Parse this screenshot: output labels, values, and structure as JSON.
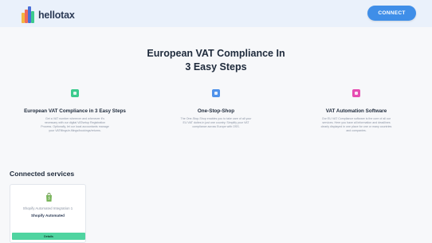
{
  "header": {
    "brand": "hellotax",
    "connect_label": "CONNECT"
  },
  "hero": {
    "title_line1": "European VAT Compliance In",
    "title_line2": "3 Easy Steps"
  },
  "features": [
    {
      "icon": "document-icon",
      "color": "#3ccb8e",
      "title": "European VAT Compliance in 3 Easy Steps",
      "text": "Get a VAT number wherever and whenever it's necessary with our digital VATsetup Registration Process. Optionally, let our local accountants manage your VATfilings/e-filings/bookings/returns."
    },
    {
      "icon": "one-stop-shop-icon",
      "color": "#4f92ea",
      "title": "One-Stop-Shop",
      "text": "The One-Stop-Shop enables you to take care of all your EU VAT duties in just one country. Simplify your VAT compliance across Europe with OSS."
    },
    {
      "icon": "automation-icon",
      "color": "#e64db2",
      "title": "VAT Automation Software",
      "text": "Our EU VAT Compliance software is the core of all our services. Here you have all information and deadlines clearly displayed in one place for one or many countries and companies."
    }
  ],
  "connected": {
    "title": "Connected services",
    "cards": [
      {
        "icon": "shopify-bag-icon",
        "title": "Shopify Automated Integration 1",
        "subtitle": "Shopify Automated",
        "button_label": "Details"
      }
    ]
  },
  "colors": {
    "accent": "#3f8ee8",
    "success": "#4fd4a0",
    "header_bg": "#eaf1fb"
  }
}
